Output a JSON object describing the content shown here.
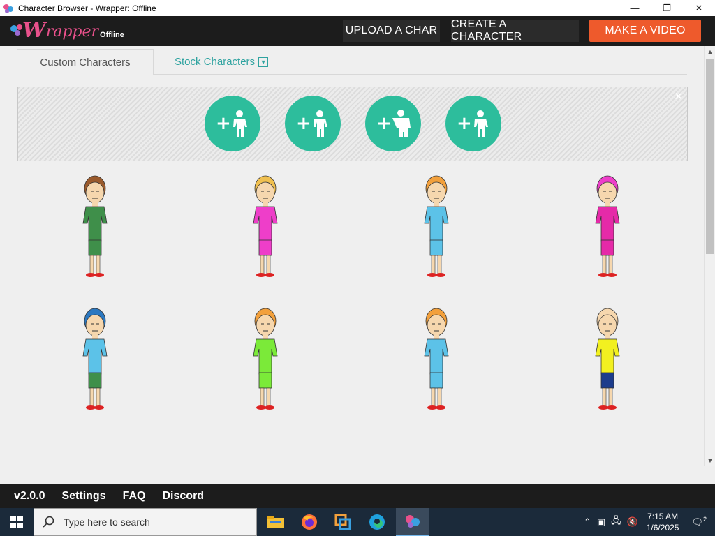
{
  "window": {
    "title": "Character Browser - Wrapper: Offline",
    "controls": {
      "minimize": "—",
      "maximize": "❐",
      "close": "✕"
    }
  },
  "header": {
    "logo_w": "W",
    "logo_rest": "rapper",
    "logo_offline": "Offline",
    "upload_label": "UPLOAD A CHAR",
    "create_label": "CREATE A CHARACTER",
    "make_video_label": "MAKE A VIDEO",
    "accent_color": "#ee5a2c"
  },
  "tabs": {
    "custom_label": "Custom Characters",
    "stock_label": "Stock Characters"
  },
  "create_panel": {
    "close": "✕",
    "buttons": [
      {
        "icon": "add-character-icon",
        "plus": "+"
      },
      {
        "icon": "add-character-icon",
        "plus": "+"
      },
      {
        "icon": "add-character-wide-icon",
        "plus": "+"
      },
      {
        "icon": "add-character-icon",
        "plus": "+"
      }
    ],
    "circle_color": "#2dbd9c"
  },
  "characters": [
    {
      "name": "boy-green-shirt",
      "skin": "#f6d7ae",
      "hair": "#9a5a2c",
      "top": "#3f8f4a",
      "bottom": "#3f8f4a"
    },
    {
      "name": "girl-pink-dress",
      "skin": "#f6d7ae",
      "hair": "#f0c050",
      "top": "#ee3ec9",
      "bottom": "#ee3ec9"
    },
    {
      "name": "girl-blue-dress",
      "skin": "#f6d7ae",
      "hair": "#f2a03c",
      "top": "#5cc2e8",
      "bottom": "#5cc2e8"
    },
    {
      "name": "woman-pink-suit",
      "skin": "#f6d7ae",
      "hair": "#ee3ec9",
      "top": "#e52aa8",
      "bottom": "#e52aa8"
    },
    {
      "name": "boy-blue-cap",
      "skin": "#f6d7ae",
      "hair": "#2c78c0",
      "top": "#5cc2e8",
      "bottom": "#3f8f4a"
    },
    {
      "name": "girl-green-dress",
      "skin": "#f6d7ae",
      "hair": "#f2a03c",
      "top": "#7bea39",
      "bottom": "#7bea39"
    },
    {
      "name": "girl-blue-dress-2",
      "skin": "#f6d7ae",
      "hair": "#f2a03c",
      "top": "#5cc2e8",
      "bottom": "#5cc2e8"
    },
    {
      "name": "bald-boy-yellow-shirt",
      "skin": "#f6d7ae",
      "hair": "#f6d7ae",
      "top": "#f2f020",
      "bottom": "#1c3c8c"
    }
  ],
  "footer": {
    "version": "v2.0.0",
    "settings": "Settings",
    "faq": "FAQ",
    "discord": "Discord"
  },
  "taskbar": {
    "search_placeholder": "Type here to search",
    "apps": [
      "file-explorer-icon",
      "firefox-icon",
      "vmware-icon",
      "edge-icon",
      "wrapper-icon"
    ],
    "time": "7:15 AM",
    "date": "1/6/2025",
    "notification_count": "2"
  }
}
